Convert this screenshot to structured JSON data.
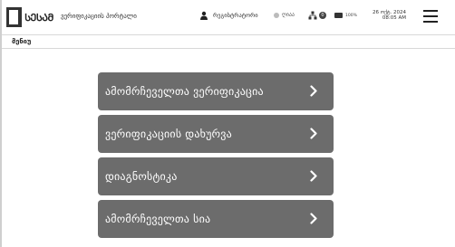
{
  "header": {
    "logo": {
      "main": "ᲡᲔᲡᲐᲛ",
      "sub": ""
    },
    "portal_title": "ვერიფიკაციის პორტალი",
    "user_name": "რეგისტრატორი",
    "status_text": "ღიაა",
    "network_badge": "0",
    "battery_text": "100%",
    "date": "26 ოქტ. 2024",
    "time": "08:05 AM",
    "icons": [
      "user-icon",
      "status-dot-icon",
      "network-icon",
      "battery-icon",
      "hamburger-icon"
    ]
  },
  "menu_bar": {
    "label": "მენიუ"
  },
  "main": {
    "buttons": [
      {
        "label": "ამომრჩეველთა ვერიფიკაცია",
        "icon": "chevron-right-icon"
      },
      {
        "label": "ვერიფიკაციის დახურვა",
        "icon": "chevron-right-icon"
      },
      {
        "label": "დიაგნოსტიკა",
        "icon": "chevron-right-icon"
      },
      {
        "label": "ამომრჩეველთა სია",
        "icon": "chevron-right-icon"
      }
    ]
  },
  "colors": {
    "button_bg": "#6c6c6c",
    "button_text": "#ffffff",
    "header_bg": "#ffffff"
  }
}
